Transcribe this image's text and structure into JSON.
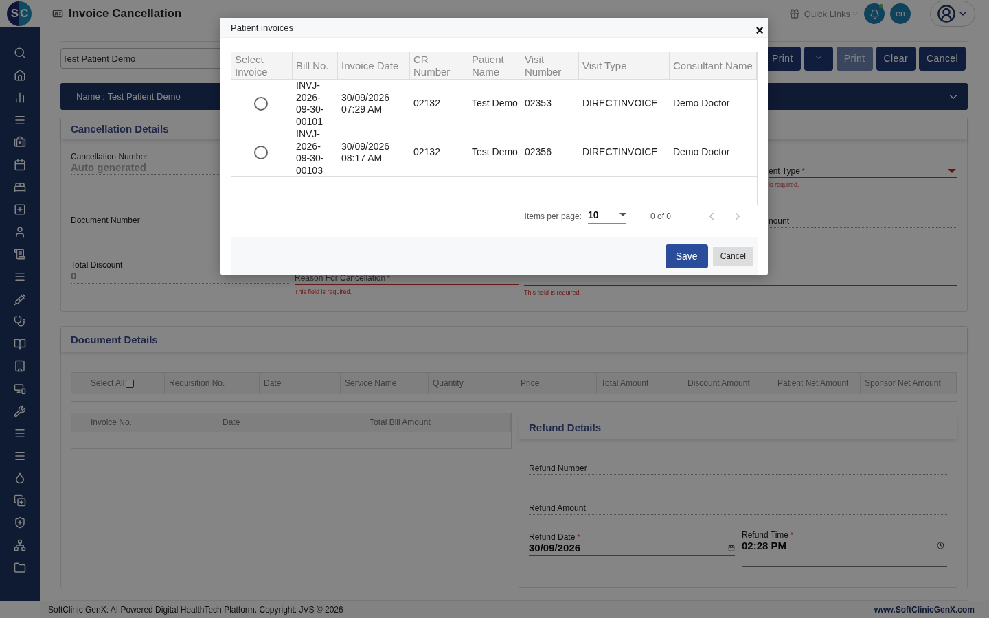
{
  "header": {
    "logo_letters": [
      "S",
      "C"
    ],
    "title": "Invoice Cancellation",
    "quick_links": "Quick Links",
    "notification": {
      "unread": true
    },
    "language": "en"
  },
  "search": {
    "value": "Test Patient Demo"
  },
  "toolbar": [
    {
      "kind": "button",
      "label": "Print",
      "disabled": false
    },
    {
      "kind": "caret",
      "disabled": false
    },
    {
      "kind": "button",
      "label": "Print",
      "disabled": true
    },
    {
      "kind": "button",
      "label": "Clear",
      "disabled": false
    },
    {
      "kind": "button",
      "label": "Cancel",
      "disabled": false
    }
  ],
  "patient_bar": {
    "label": "Name :",
    "value": "Test Patient Demo"
  },
  "cancellation_details": {
    "title": "Cancellation Details",
    "left_fields": [
      {
        "label": "Cancellation Number",
        "placeholder": "Auto generated"
      },
      {
        "label": "Document Number"
      },
      {
        "label": "Total Discount",
        "value": "0"
      }
    ],
    "reason": {
      "label": "Reason For Cancellation",
      "mark": "*",
      "error": "This field is required."
    },
    "remarks": {
      "error": "This field is required."
    },
    "type_field": {
      "label": "ent Type",
      "mark": "*",
      "error": "is required."
    },
    "amount_field": {
      "label": "nount"
    }
  },
  "document_details": {
    "title": "Document Details",
    "select_all": {
      "label": "Select All",
      "checked": false
    },
    "columns": [
      "Requisition No.",
      "Date",
      "Service Name",
      "Quantity",
      "Price",
      "Total Amount",
      "Discount Amount",
      "Patient Net Amount",
      "Sponsor Net Amount"
    ],
    "invoice_columns": [
      "Invoice No.",
      "Date",
      "Total Bill Amount"
    ]
  },
  "refund_details": {
    "title": "Refund Details",
    "fields": [
      {
        "label": "Refund Number"
      },
      {
        "label": "Refund Amount"
      }
    ],
    "date": {
      "label": "Refund Date",
      "mark": "*",
      "value": "30/09/2026"
    },
    "time": {
      "label": "Refund Time",
      "mark": "*",
      "value": "02:28 PM"
    }
  },
  "footer": {
    "text": "SoftClinic GenX: AI Powered Digital HealthTech Platform. Copyright: JVS © 2026",
    "link": "www.SoftClinicGenX.com"
  },
  "modal": {
    "title": "Patient invoices",
    "close": "×",
    "columns": [
      "Select Invoice",
      "Bill No.",
      "Invoice Date",
      "CR Number",
      "Patient Name",
      "Visit Number",
      "Visit Type",
      "Consultant Name"
    ],
    "rows": [
      {
        "selected": false,
        "bill_no": "INVJ-2026-09-30-00101",
        "invoice_date": "30/09/2026 07:29 AM",
        "cr_number": "02132",
        "patient_name": "Test Demo",
        "visit_number": "02353",
        "visit_type": "DIRECTINVOICE",
        "consultant": "Demo Doctor"
      },
      {
        "selected": false,
        "bill_no": "INVJ-2026-09-30-00103",
        "invoice_date": "30/09/2026 08:17 AM",
        "cr_number": "02132",
        "patient_name": "Test Demo",
        "visit_number": "02356",
        "visit_type": "DIRECTINVOICE",
        "consultant": "Demo Doctor"
      }
    ],
    "paginator": {
      "label": "Items per page:",
      "page_size": "10",
      "range": "0 of 0"
    },
    "save": "Save",
    "cancel": "Cancel"
  }
}
